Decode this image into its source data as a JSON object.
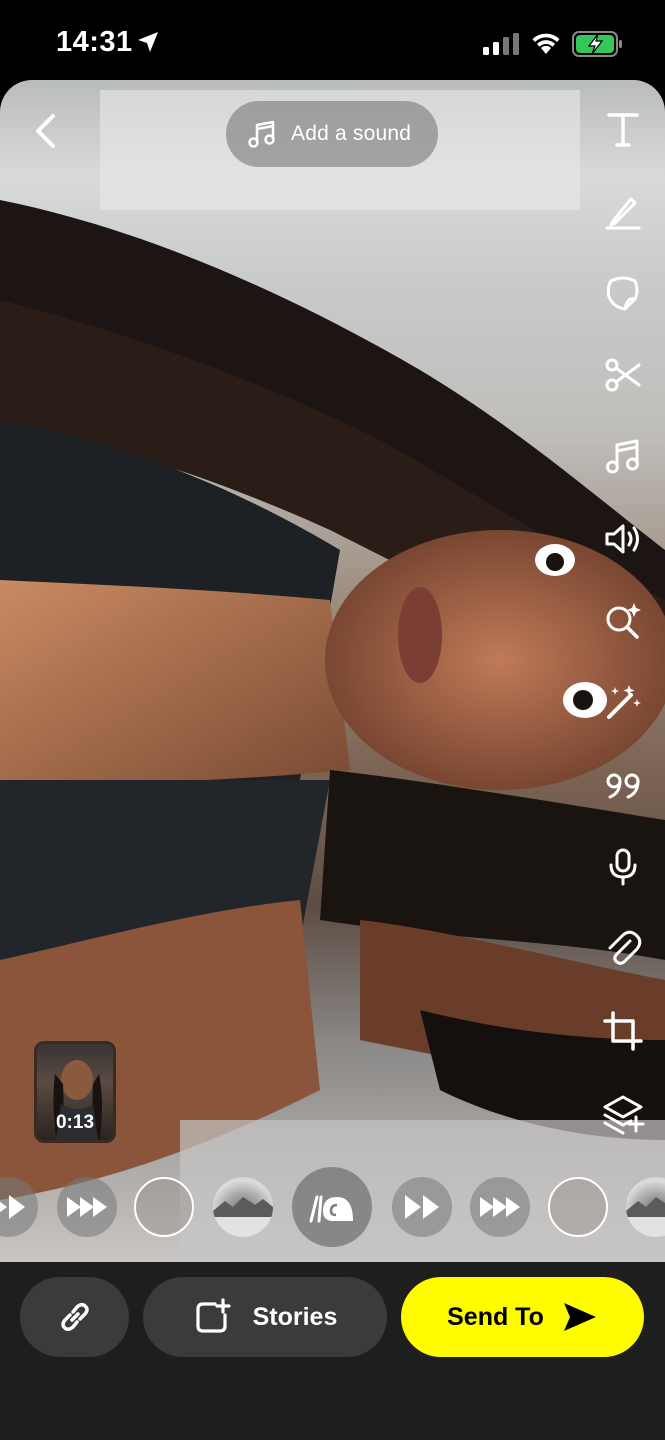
{
  "status_bar": {
    "time": "14:31"
  },
  "editor": {
    "add_sound_label": "Add a sound",
    "tools": [
      "text-icon",
      "pencil-icon",
      "sticker-icon",
      "scissors-icon",
      "music-icon",
      "volume-icon",
      "search-sparkle-icon",
      "magic-wand-icon",
      "quote-icon",
      "microphone-icon",
      "paperclip-icon",
      "crop-icon",
      "layers-add-icon"
    ],
    "thumbnail_duration": "0:13",
    "speed_options": [
      "fast-forward",
      "fastest-forward",
      "none",
      "landscape-lens",
      "slow-motion",
      "fast-forward",
      "fastest-forward",
      "none",
      "landscape-lens"
    ]
  },
  "bottom_bar": {
    "stories_label": "Stories",
    "send_label": "Send To"
  },
  "colors": {
    "send_button": "#fffc00",
    "bottom_bar": "#1e1e1e",
    "pill": "#3b3b3b"
  }
}
